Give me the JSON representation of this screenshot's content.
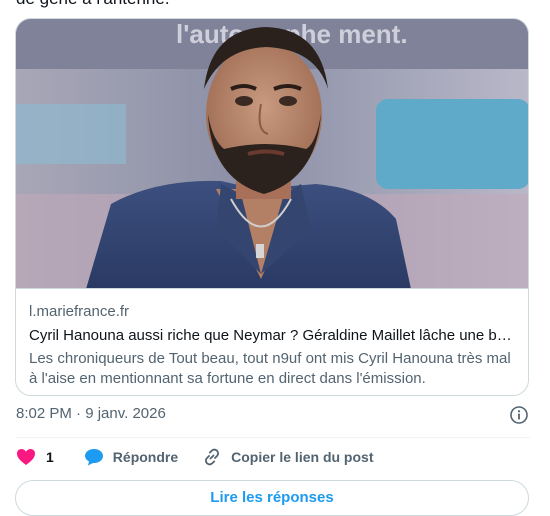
{
  "post": {
    "text_tail": "de gêne à l'antenne.",
    "timestamp": "8:02 PM · 9 janv. 2026"
  },
  "card": {
    "image_overlay_text": "l'autographe ment.",
    "domain": "l.mariefrance.fr",
    "title": "Cyril Hanouna aussi riche que Neymar ? Géraldine Maillet lâche une bo...",
    "description": "Les chroniqueurs de Tout beau, tout n9uf ont mis Cyril Hanouna très mal à l'aise en mentionnant sa fortune en direct dans l'émission."
  },
  "actions": {
    "like_count": "1",
    "reply_label": "Répondre",
    "copy_label": "Copier le lien du post"
  },
  "more_button": {
    "label": "Lire les réponses"
  },
  "icons": {
    "like": "heart-icon",
    "reply": "speech-bubble-icon",
    "copy": "link-icon",
    "info": "info-icon"
  },
  "colors": {
    "like": "#f91880",
    "reply": "#1d9bf0",
    "secondary_text": "#536471",
    "border": "#cfd9de"
  }
}
